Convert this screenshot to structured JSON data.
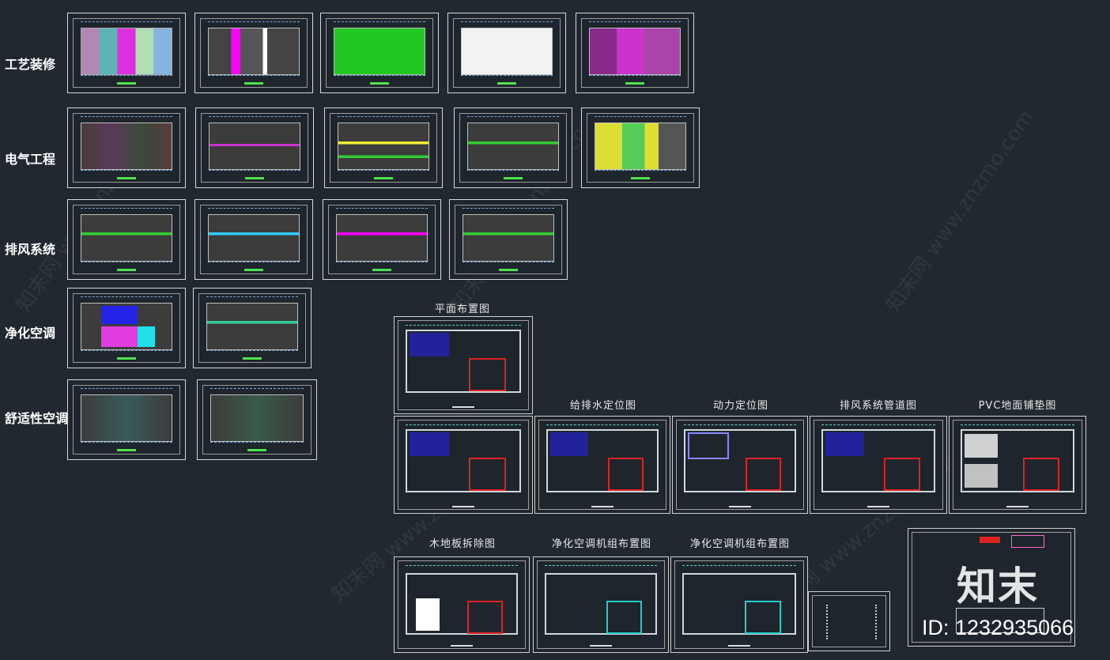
{
  "categories": [
    "工艺装修",
    "电气工程",
    "排风系统",
    "净化空调",
    "舒适性空调"
  ],
  "sheet_titles": {
    "plan_layout": "平面布置图",
    "water": "给排水定位图",
    "power": "动力定位图",
    "exhaust": "排风系统管道图",
    "pvc": "PVC地面铺垫图",
    "wood": "木地板拆除图",
    "ac1": "净化空调机组布置图",
    "ac2": "净化空调机组布置图"
  },
  "watermark_text": "知末网 www.znzmo.com",
  "logo_text": "知末",
  "id_label": "ID: 1232935066",
  "colors": {
    "background": "#212830",
    "border": "#d8d8d8",
    "accent_green": "#22c822",
    "accent_magenta": "#e23ce2",
    "accent_blue": "#2323e8",
    "accent_cyan": "#22e0e8"
  }
}
